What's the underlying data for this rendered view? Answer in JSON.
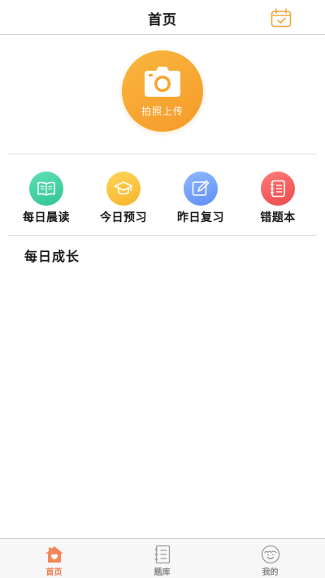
{
  "header": {
    "title": "首页"
  },
  "upload": {
    "label": "拍照上传"
  },
  "menu": [
    {
      "label": "每日晨读",
      "color_start": "#5fe0b4",
      "color_end": "#2fc594"
    },
    {
      "label": "今日预习",
      "color_start": "#fdd45a",
      "color_end": "#f7b52b"
    },
    {
      "label": "昨日复习",
      "color_start": "#8fb8ff",
      "color_end": "#5e8ff5"
    },
    {
      "label": "错题本",
      "color_start": "#ff7a7a",
      "color_end": "#ec4b4b"
    }
  ],
  "section": {
    "title": "每日成长"
  },
  "tabbar": {
    "items": [
      {
        "label": "首页",
        "icon": "home-icon",
        "active": true
      },
      {
        "label": "题库",
        "icon": "notebook-icon",
        "active": false
      },
      {
        "label": "我的",
        "icon": "profile-face-icon",
        "active": false
      }
    ],
    "active_color": "#f07b4a",
    "inactive_color": "#8a8a8a"
  },
  "colors": {
    "accent_orange": "#f6a52f",
    "divider": "#dcdcdc"
  }
}
